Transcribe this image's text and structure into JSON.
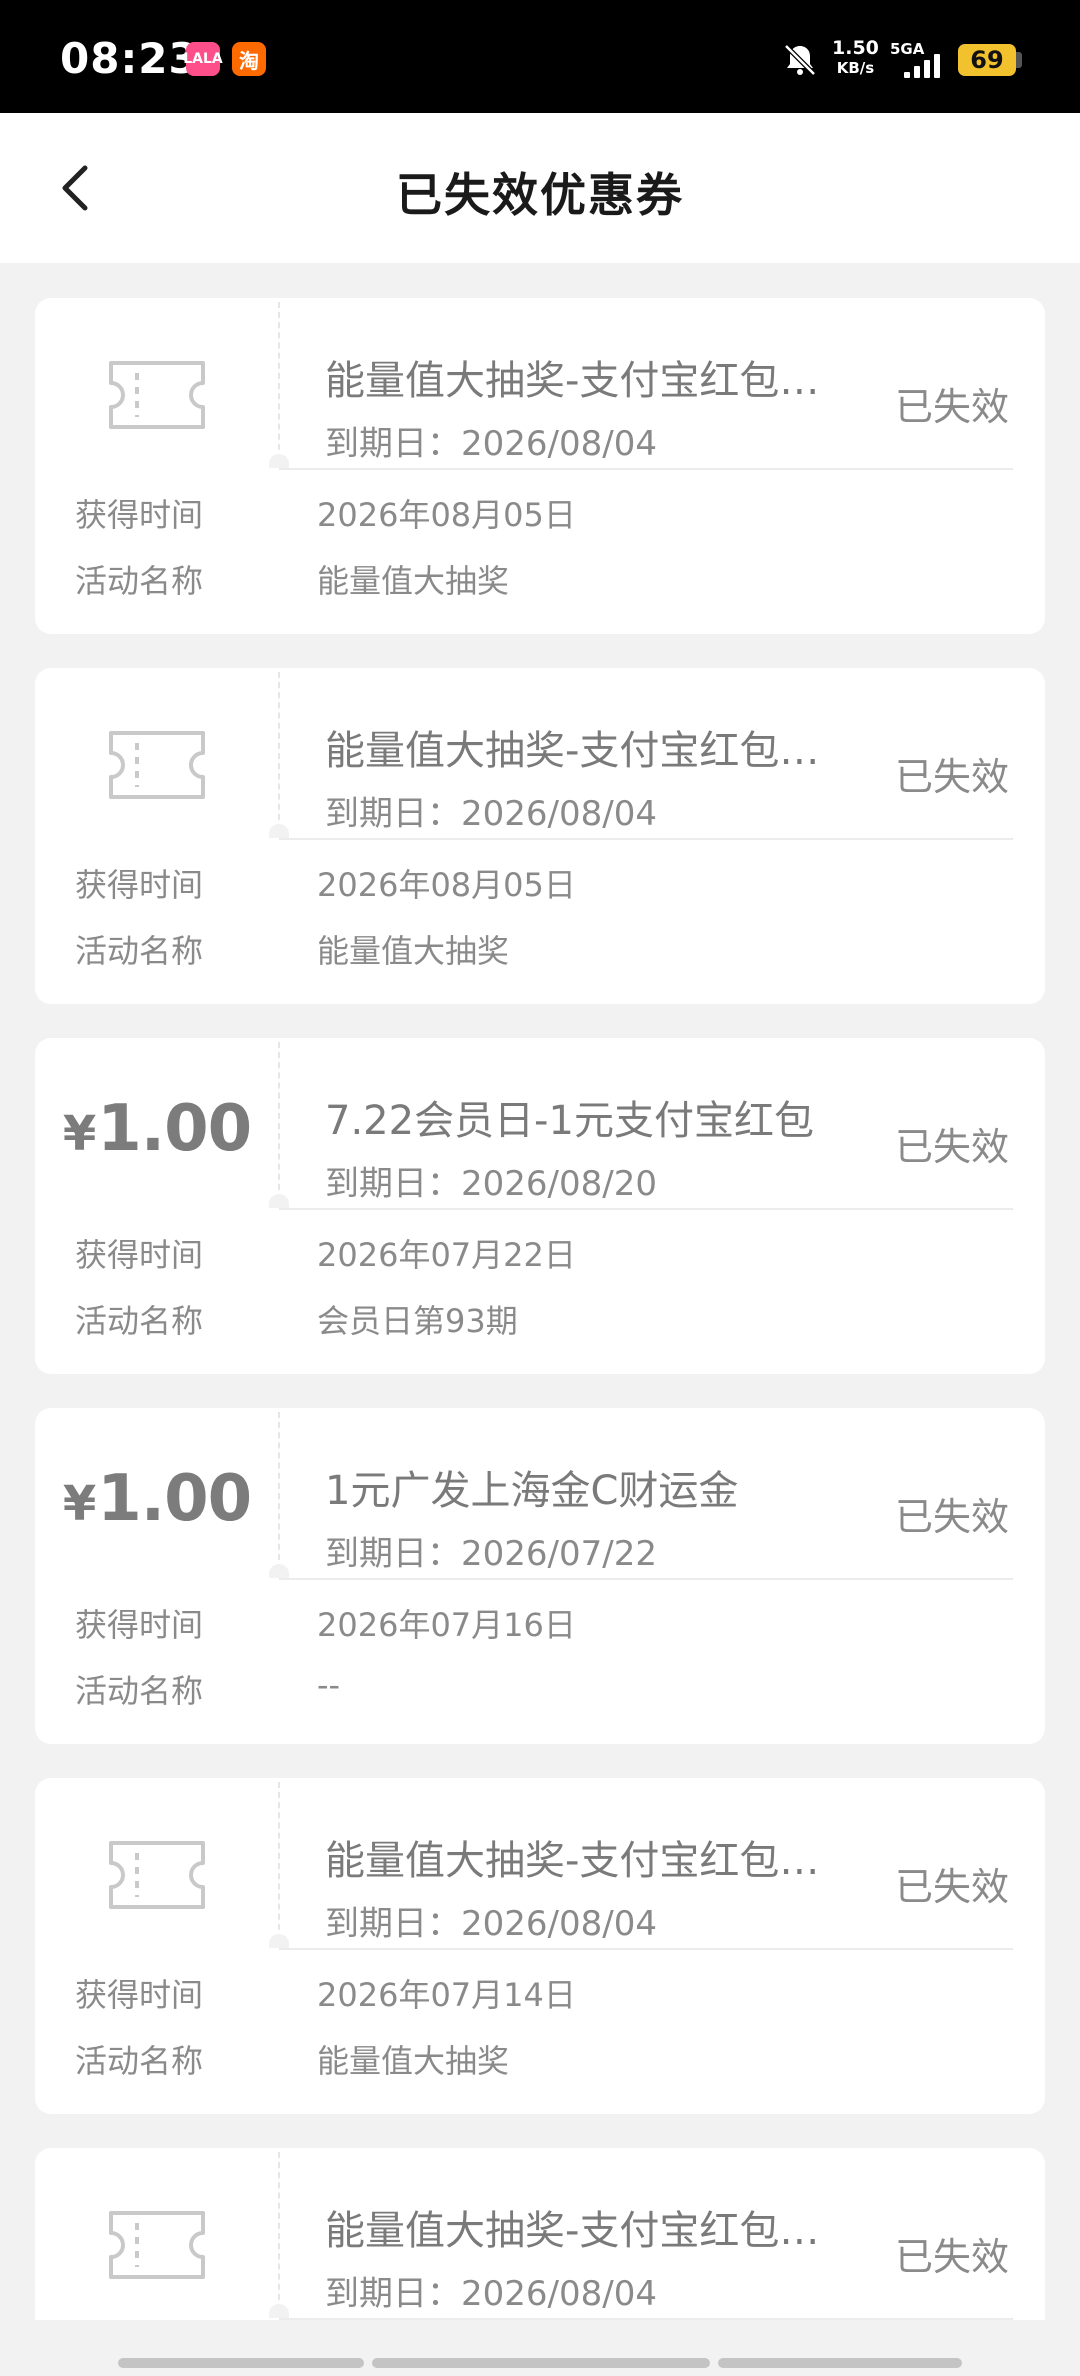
{
  "status_bar": {
    "time": "08:23",
    "app_icons": [
      "LALA",
      "淘"
    ],
    "speed_value": "1.50",
    "speed_unit": "KB/s",
    "network": "5GA",
    "battery": "69",
    "battery_color": "#f2c12e"
  },
  "header": {
    "title": "已失效优惠券",
    "back_icon": "chevron-left-icon"
  },
  "labels": {
    "obtained_time": "获得时间",
    "activity_name": "活动名称"
  },
  "coupons": [
    {
      "type": "ticket-icon",
      "title": "能量值大抽奖-支付宝红包…",
      "expiry": "到期日：2026/08/04",
      "status": "已失效",
      "obtained_time": "2026年08月05日",
      "activity_name": "能量值大抽奖"
    },
    {
      "type": "ticket-icon",
      "title": "能量值大抽奖-支付宝红包…",
      "expiry": "到期日：2026/08/04",
      "status": "已失效",
      "obtained_time": "2026年08月05日",
      "activity_name": "能量值大抽奖"
    },
    {
      "type": "amount",
      "currency": "¥",
      "amount": "1.00",
      "title": "7.22会员日-1元支付宝红包",
      "expiry": "到期日：2026/08/20",
      "status": "已失效",
      "obtained_time": "2026年07月22日",
      "activity_name": "会员日第93期"
    },
    {
      "type": "amount",
      "currency": "¥",
      "amount": "1.00",
      "title": "1元广发上海金C财运金",
      "expiry": "到期日：2026/07/22",
      "status": "已失效",
      "obtained_time": "2026年07月16日",
      "activity_name": "--"
    },
    {
      "type": "ticket-icon",
      "title": "能量值大抽奖-支付宝红包…",
      "expiry": "到期日：2026/08/04",
      "status": "已失效",
      "obtained_time": "2026年07月14日",
      "activity_name": "能量值大抽奖"
    },
    {
      "type": "ticket-icon",
      "title": "能量值大抽奖-支付宝红包…",
      "expiry": "到期日：2026/08/04",
      "status": "已失效",
      "obtained_time": "",
      "activity_name": ""
    }
  ]
}
